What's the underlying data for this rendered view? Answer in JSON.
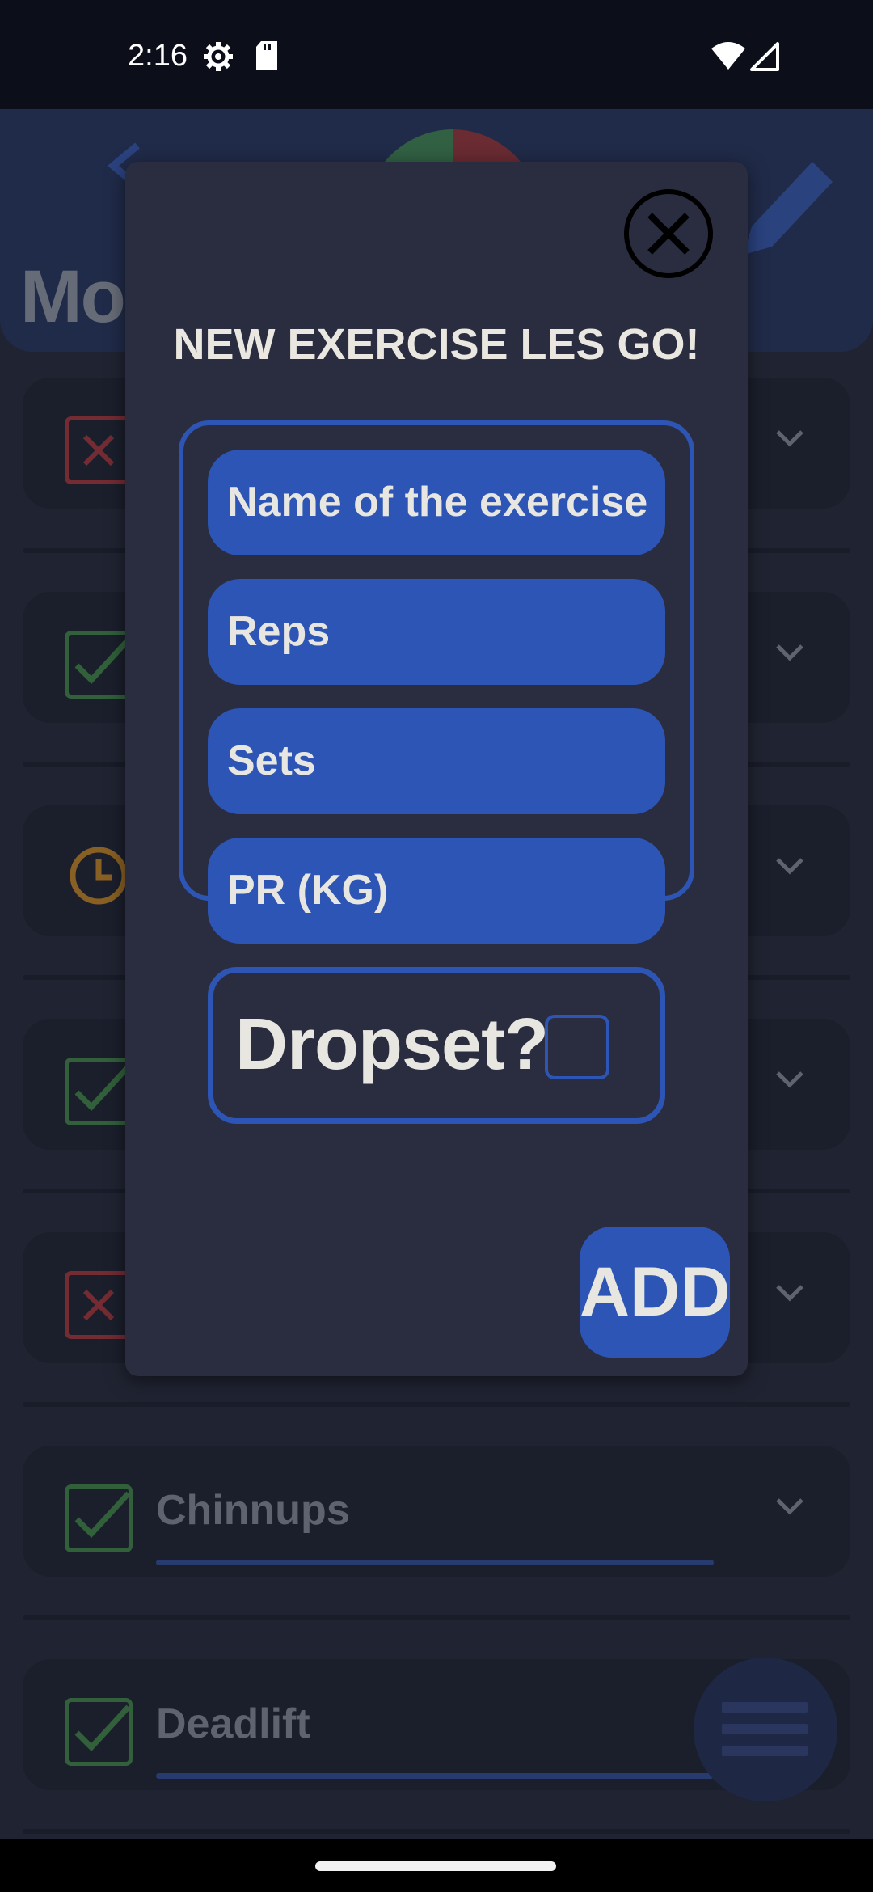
{
  "status_bar": {
    "time": "2:16"
  },
  "header": {
    "title": "Mon"
  },
  "background_list": [
    {
      "status": "failed",
      "label": ""
    },
    {
      "status": "done",
      "label": ""
    },
    {
      "status": "pending",
      "label": ""
    },
    {
      "status": "done",
      "label": ""
    },
    {
      "status": "failed",
      "label": ""
    },
    {
      "status": "done",
      "label": "Chinnups"
    },
    {
      "status": "done",
      "label": "Deadlift"
    }
  ],
  "dialog": {
    "title": "NEW EXERCISE LES GO!",
    "fields": {
      "name_placeholder": "Name of the exercise",
      "reps_placeholder": "Reps",
      "sets_placeholder": "Sets",
      "pr_placeholder": "PR (KG)"
    },
    "dropset_label": "Dropset?",
    "dropset_checked": false,
    "add_label": "ADD"
  },
  "colors": {
    "accent": "#2c55b5",
    "done": "#3a8a3a",
    "failed": "#b22a2a",
    "pending": "#d98a10"
  }
}
